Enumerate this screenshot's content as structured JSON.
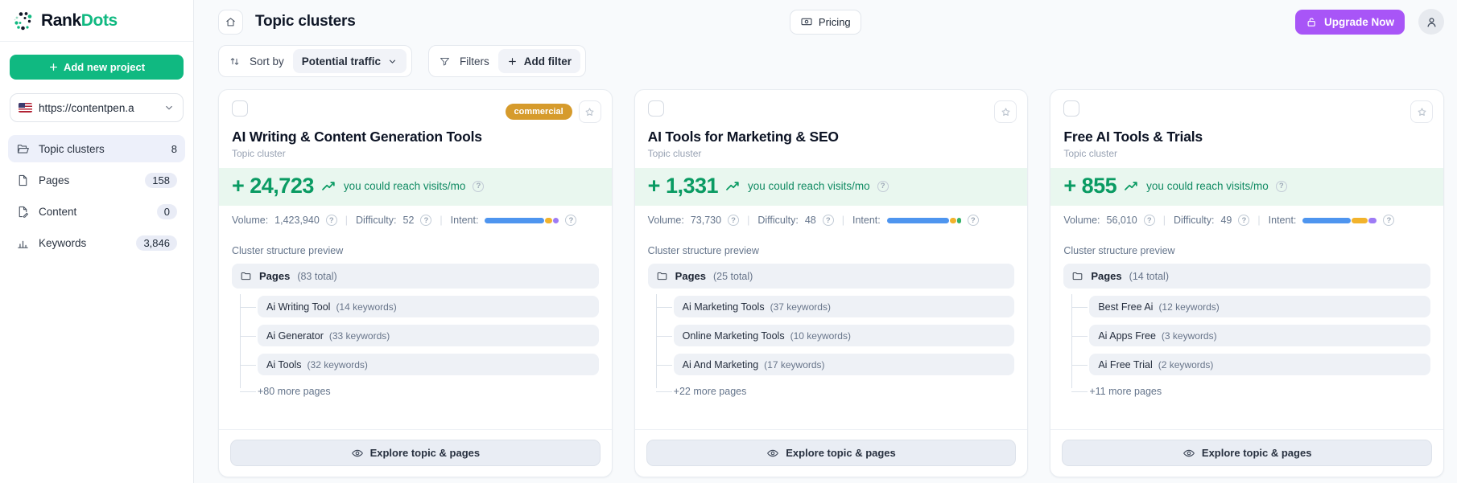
{
  "brand": {
    "logo_primary": "Rank",
    "logo_secondary": "Dots",
    "accent_green": "#10b981",
    "accent_purple": "#a855f7"
  },
  "sidebar": {
    "add_project": "Add new project",
    "project_url": "https://contentpen.a",
    "nav": [
      {
        "label": "Topic clusters",
        "count": "8"
      },
      {
        "label": "Pages",
        "count": "158"
      },
      {
        "label": "Content",
        "count": "0"
      },
      {
        "label": "Keywords",
        "count": "3,846"
      }
    ]
  },
  "header": {
    "title": "Topic clusters",
    "pricing": "Pricing",
    "upgrade": "Upgrade Now"
  },
  "toolbar": {
    "sort_label": "Sort by",
    "sort_value": "Potential traffic",
    "filters_label": "Filters",
    "add_filter": "Add filter"
  },
  "shared": {
    "type_label": "Topic cluster",
    "reach_suffix": "you could reach visits/mo",
    "volume_label": "Volume:",
    "difficulty_label": "Difficulty:",
    "intent_label": "Intent:",
    "preview_label": "Cluster structure preview",
    "pages_label": "Pages",
    "explore_label": "Explore topic & pages"
  },
  "cards": [
    {
      "title": "AI Writing & Content Generation Tools",
      "badge": "commercial",
      "reach": "+ 24,723",
      "volume": "1,423,940",
      "difficulty": "52",
      "intent_segments": [
        {
          "color": "#4e95ef",
          "pct": 82
        },
        {
          "color": "#f2b32c",
          "pct": 10
        },
        {
          "color": "#9d7bf5",
          "pct": 8
        }
      ],
      "pages_total": "(83 total)",
      "children": [
        {
          "name": "Ai Writing Tool",
          "count": "(14 keywords)"
        },
        {
          "name": "Ai Generator",
          "count": "(33 keywords)"
        },
        {
          "name": "Ai Tools",
          "count": "(32 keywords)"
        }
      ],
      "more": "+80 more pages"
    },
    {
      "title": "AI Tools for Marketing & SEO",
      "badge": "",
      "reach": "+ 1,331",
      "volume": "73,730",
      "difficulty": "48",
      "intent_segments": [
        {
          "color": "#4e95ef",
          "pct": 86
        },
        {
          "color": "#f2b32c",
          "pct": 9
        },
        {
          "color": "#35b26a",
          "pct": 5
        }
      ],
      "pages_total": "(25 total)",
      "children": [
        {
          "name": "Ai Marketing Tools",
          "count": "(37 keywords)"
        },
        {
          "name": "Online Marketing Tools",
          "count": "(10 keywords)"
        },
        {
          "name": "Ai And Marketing",
          "count": "(17 keywords)"
        }
      ],
      "more": "+22 more pages"
    },
    {
      "title": "Free AI Tools & Trials",
      "badge": "",
      "reach": "+ 855",
      "volume": "56,010",
      "difficulty": "49",
      "intent_segments": [
        {
          "color": "#4e95ef",
          "pct": 66
        },
        {
          "color": "#f2b32c",
          "pct": 22
        },
        {
          "color": "#9d7bf5",
          "pct": 12
        }
      ],
      "pages_total": "(14 total)",
      "children": [
        {
          "name": "Best Free Ai",
          "count": "(12 keywords)"
        },
        {
          "name": "Ai Apps Free",
          "count": "(3 keywords)"
        },
        {
          "name": "Ai Free Trial",
          "count": "(2 keywords)"
        }
      ],
      "more": "+11 more pages"
    }
  ]
}
